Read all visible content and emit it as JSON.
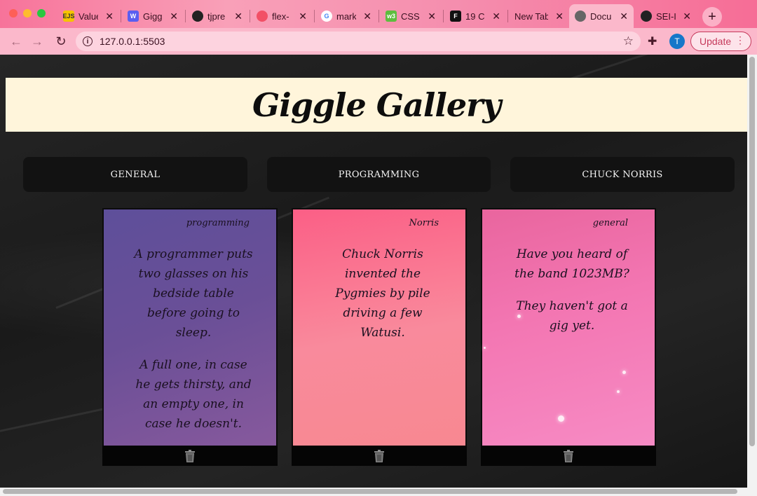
{
  "browser": {
    "tabs": [
      {
        "label": "Value",
        "favicon": "ejs-icon",
        "favicon_text": "EJS",
        "favicon_color": "#f5c400"
      },
      {
        "label": "Giggl",
        "favicon": "w-icon",
        "favicon_text": "W",
        "favicon_color": "#5a5ef0"
      },
      {
        "label": "tjpre",
        "favicon": "github-icon",
        "favicon_text": "",
        "favicon_color": "#222222"
      },
      {
        "label": "flex-",
        "favicon": "flex-icon",
        "favicon_text": "",
        "favicon_color": "#f25066"
      },
      {
        "label": "mark",
        "favicon": "google-icon",
        "favicon_text": "G",
        "favicon_color": "#4285f4"
      },
      {
        "label": "CSS",
        "favicon": "w3-icon",
        "favicon_text": "w3",
        "favicon_color": "#5ebd3e"
      },
      {
        "label": "19 C",
        "favicon": "f-icon",
        "favicon_text": "F",
        "favicon_color": "#111111"
      },
      {
        "label": "New Tab",
        "favicon": "",
        "favicon_text": "",
        "favicon_color": ""
      },
      {
        "label": "Docu",
        "favicon": "globe-icon",
        "favicon_text": "",
        "favicon_color": "#555555"
      },
      {
        "label": "SEI-I",
        "favicon": "github-icon",
        "favicon_text": "",
        "favicon_color": "#222222"
      }
    ],
    "active_tab_index": 8,
    "url": "127.0.0.1:5503",
    "avatar_initial": "T",
    "update_label": "Update"
  },
  "page": {
    "title": "Giggle Gallery",
    "categories": [
      "GENERAL",
      "PROGRAMMING",
      "CHUCK NORRIS"
    ],
    "cards": [
      {
        "category": "programming",
        "setup": "A programmer puts two glasses on his bedside table before going to sleep.",
        "punchline": "A full one, in case he gets thirsty, and an empty one, in case he doesn't."
      },
      {
        "category": "Norris",
        "setup": "Chuck Norris invented the Pygmies by pile driving a few Watusi.",
        "punchline": ""
      },
      {
        "category": "general",
        "setup": "Have you heard of the band 1023MB?",
        "punchline": "They haven't got a gig yet."
      }
    ]
  },
  "colors": {
    "header_band": "#fff5db",
    "category_button": "#121212",
    "card_programming": "#6a4f97",
    "card_norris": "#f98a9c",
    "card_general": "#f376b2"
  }
}
